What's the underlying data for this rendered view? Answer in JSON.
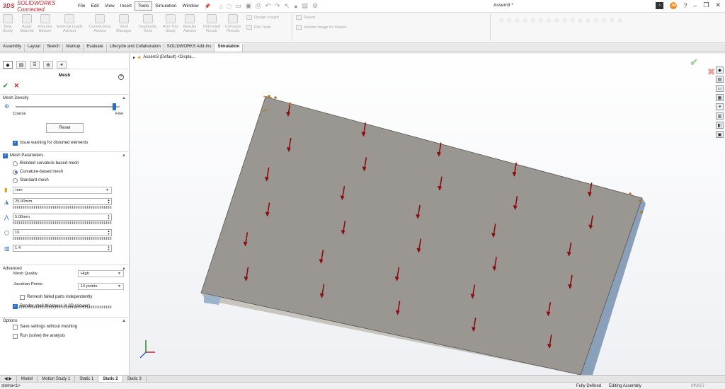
{
  "app": {
    "brand_mark": "3DS",
    "brand_name": "SOLIDWORKS Connected",
    "doc_title": "Assem3 *",
    "user_initials": "JM"
  },
  "menu": [
    "File",
    "Edit",
    "View",
    "Insert",
    "Tools",
    "Simulation",
    "Window"
  ],
  "menu_active": "Tools",
  "ribbon": {
    "buttons": [
      {
        "l1": "New",
        "l2": "Study"
      },
      {
        "l1": "Apply",
        "l2": "Material"
      },
      {
        "l1": "Fixtures",
        "l2": "Advisor"
      },
      {
        "l1": "External Loads",
        "l2": "Advisor"
      },
      {
        "l1": "Connections",
        "l2": "Advisor"
      },
      {
        "l1": "Shell",
        "l2": "Manager"
      },
      {
        "l1": "Diagnostic",
        "l2": "Tools"
      },
      {
        "l1": "Run This",
        "l2": "Study"
      },
      {
        "l1": "Results",
        "l2": "Advisor"
      },
      {
        "l1": "Deformed",
        "l2": "Result"
      },
      {
        "l1": "Compare",
        "l2": "Results"
      }
    ],
    "design_insight": "Design Insight",
    "plot_tools": "Plot Tools",
    "report": "Report",
    "include_image": "Include Image for Report"
  },
  "command_tabs": [
    "Assembly",
    "Layout",
    "Sketch",
    "Markup",
    "Evaluate",
    "Lifecycle and Collaboration",
    "SOLIDWORKS Add-Ins",
    "Simulation"
  ],
  "command_tab_active": "Simulation",
  "panel": {
    "title": "Mesh",
    "help": "?",
    "density": {
      "header": "Mesh Density",
      "coarse": "Coarse",
      "fine": "Fine",
      "level": 0.95,
      "reset": "Reset",
      "distorted_warning": "Issue warning for distorted elements",
      "distorted_checked": true
    },
    "params": {
      "header": "Mesh Parameters",
      "header_checked": true,
      "options": [
        {
          "label": "Blended curvature-based mesh",
          "selected": false
        },
        {
          "label": "Curvature-based mesh",
          "selected": true
        },
        {
          "label": "Standard mesh",
          "selected": false
        }
      ],
      "unit": "mm",
      "max_element": "25.00mm",
      "min_element": "5.00mm",
      "min_circle": "16",
      "growth_ratio": "1.4"
    },
    "advanced": {
      "header": "Advanced",
      "quality_label": "Mesh Quality",
      "quality_value": "High",
      "jacobian_label": "Jacobian Points",
      "jacobian_value": "16 points",
      "remesh": "Remesh failed parts independently",
      "remesh_checked": false,
      "render_shell": "Render shell thickness in 3D (slower)",
      "render_shell_checked": true
    },
    "options": {
      "header": "Options",
      "save": "Save settings without meshing",
      "run": "Run (solve) the analysis"
    }
  },
  "viewport": {
    "tree_label": "Assem3 (Default) <Displa..."
  },
  "bottom_tabs": [
    "Model",
    "Motion Study 1",
    "Static 1",
    "Static 2",
    "Static 3"
  ],
  "bottom_tab_active": "Static 2",
  "status": {
    "left": "streha<1>",
    "defined": "Fully Defined",
    "mode": "Editing Assembly",
    "units": "MMGS"
  },
  "colors": {
    "accent": "#2b6cc4",
    "brand": "#d71e28",
    "plate": "#9a9691",
    "load_arrow": "#8a0e0e"
  }
}
